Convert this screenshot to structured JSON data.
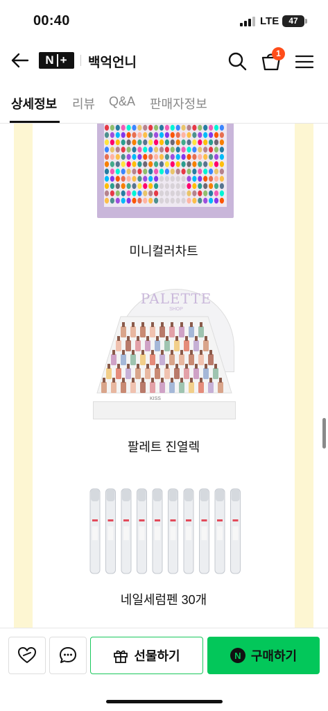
{
  "status_bar": {
    "time": "00:40",
    "network": "LTE",
    "battery": "47",
    "battery_level": 0.47
  },
  "header": {
    "back_icon": "arrow-left-icon",
    "logo_left": "N",
    "logo_right": "+",
    "store_name": "백억언니",
    "search_icon": "search-icon",
    "cart_icon": "shopping-bag-icon",
    "cart_count": "1",
    "menu_icon": "hamburger-menu-icon"
  },
  "tabs": [
    {
      "label": "상세정보",
      "active": true
    },
    {
      "label": "리뷰",
      "active": false
    },
    {
      "label": "Q&A",
      "active": false
    },
    {
      "label": "판매자정보",
      "active": false
    }
  ],
  "content": {
    "items": [
      {
        "caption": "미니컬러차트"
      },
      {
        "caption": "팔레트 진열렉",
        "display_title": "PALETTE",
        "display_sub": "SHOP",
        "display_brand": "KISS"
      },
      {
        "caption": "네일세럼펜 30개"
      }
    ]
  },
  "bottom_bar": {
    "like_icon": "heart-icon",
    "talk_icon": "chat-bubble-icon",
    "gift_icon": "gift-icon",
    "gift_label": "선물하기",
    "buy_icon": "naver-n-icon",
    "buy_label": "구매하기",
    "buy_icon_letter": "N"
  },
  "colors": {
    "accent": "#03c75a",
    "badge": "#ff4d1a",
    "side_band": "#fdf6d2"
  }
}
